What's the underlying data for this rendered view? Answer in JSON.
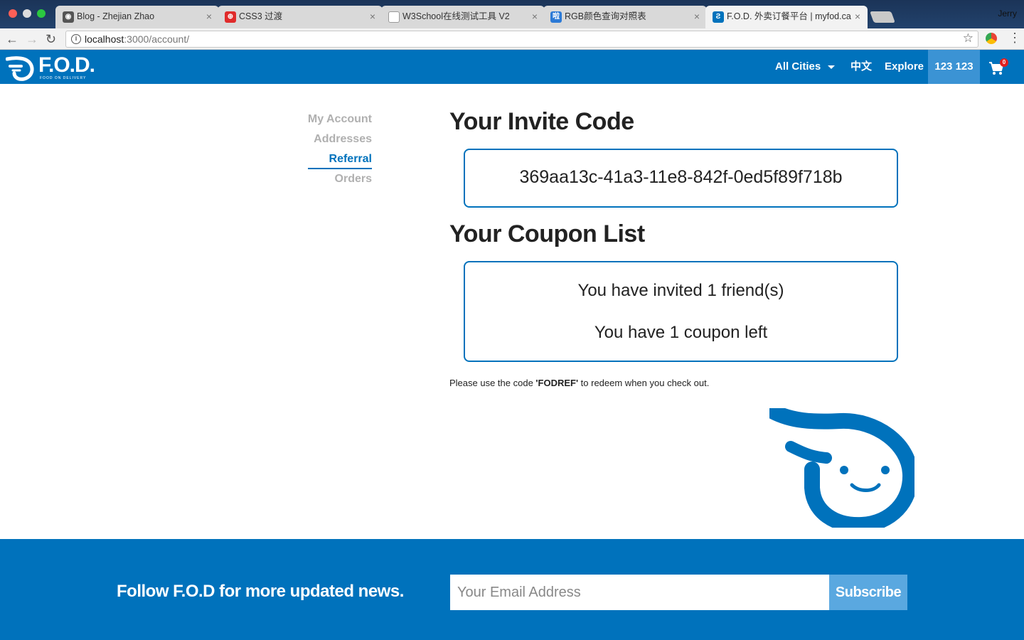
{
  "browser": {
    "tabs": [
      {
        "title": "Blog - Zhejian Zhao",
        "favicon": "avatar-icon"
      },
      {
        "title": "CSS3 过渡",
        "favicon": "w3school-icon"
      },
      {
        "title": "W3School在线测试工具 V2",
        "favicon": "document-icon"
      },
      {
        "title": "RGB颜色查询对照表",
        "favicon": "site-icon"
      },
      {
        "title": "F.O.D. 外卖订餐平台 | myfod.ca",
        "favicon": "fod-icon",
        "active": true
      }
    ],
    "close_glyph": "×",
    "profile_name": "Jerry",
    "url_host": "localhost",
    "url_path": ":3000/account/",
    "back_glyph": "←",
    "forward_glyph": "→",
    "reload_glyph": "↻",
    "star_glyph": "☆",
    "menu_glyph": "⋮",
    "info_glyph": "i"
  },
  "header": {
    "logo_text": "F.O.D.",
    "logo_tagline": "FOOD ON DELIVERY",
    "cities_label": "All Cities",
    "lang_label": "中文",
    "explore_label": "Explore",
    "user_label": "123 123",
    "cart_count": "0",
    "brand_color": "#0072bc"
  },
  "sidebar": {
    "items": [
      {
        "label": "My Account"
      },
      {
        "label": "Addresses"
      },
      {
        "label": "Referral",
        "active": true
      },
      {
        "label": "Orders"
      }
    ]
  },
  "main": {
    "invite_heading": "Your Invite Code",
    "invite_code": "369aa13c-41a3-11e8-842f-0ed5f89f718b",
    "coupon_heading": "Your Coupon List",
    "invited_text": "You have invited 1 friend(s)",
    "coupon_text": "You have 1 coupon left",
    "note_prefix": "Please use the code ",
    "note_code": "'FODREF'",
    "note_suffix": " to redeem when you check out."
  },
  "footer": {
    "follow_text": "Follow F.O.D for more updated news.",
    "email_placeholder": "Your Email Address",
    "subscribe_label": "Subscribe"
  }
}
